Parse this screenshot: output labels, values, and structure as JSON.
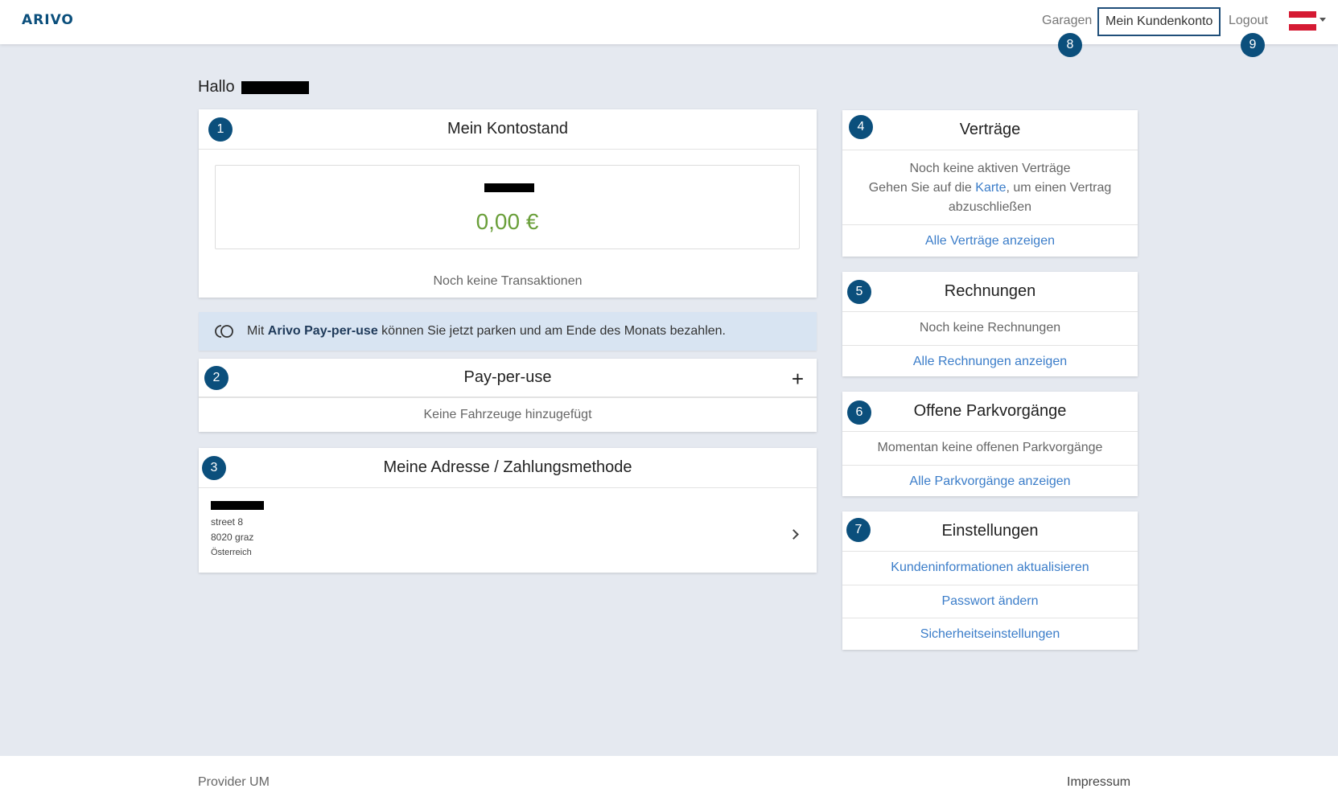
{
  "header": {
    "logo": "ARIVO",
    "nav": {
      "garagen": "Garagen",
      "konto": "Mein Kundenkonto",
      "logout": "Logout"
    }
  },
  "badges": [
    "1",
    "2",
    "3",
    "4",
    "5",
    "6",
    "7",
    "8",
    "9"
  ],
  "greeting": "Hallo",
  "kontostand": {
    "title": "Mein Kontostand",
    "amount": "0,00 €",
    "no_transactions": "Noch keine Transaktionen"
  },
  "info_banner": {
    "prefix": "Mit ",
    "brand": "Arivo Pay-per-use",
    "suffix": " können Sie jetzt parken und am Ende des Monats bezahlen."
  },
  "payperuse": {
    "title": "Pay-per-use",
    "plus": "+",
    "empty": "Keine Fahrzeuge hinzugefügt"
  },
  "adresse": {
    "title": "Meine Adresse / Zahlungsmethode",
    "street": "street 8",
    "city": "8020 graz",
    "country": "Österreich"
  },
  "vertraege": {
    "title": "Verträge",
    "empty": "Noch keine aktiven Verträge",
    "hint_pre": "Gehen Sie auf die ",
    "hint_link": "Karte",
    "hint_post": ", um einen Vertrag abzuschließen",
    "link": "Alle Verträge anzeigen"
  },
  "rechnungen": {
    "title": "Rechnungen",
    "empty": "Noch keine Rechnungen",
    "link": "Alle Rechnungen anzeigen"
  },
  "parkvorgaenge": {
    "title": "Offene Parkvorgänge",
    "empty": "Momentan keine offenen Parkvorgänge",
    "link": "Alle Parkvorgänge anzeigen"
  },
  "einstellungen": {
    "title": "Einstellungen",
    "links": [
      "Kundeninformationen aktualisieren",
      "Passwort ändern",
      "Sicherheitseinstellungen"
    ]
  },
  "footer": {
    "left": "Provider UM",
    "right": "Impressum"
  },
  "colors": {
    "brand": "#0b4f7c",
    "link": "#3b7dc9",
    "amount": "#6a9f3a",
    "banner": "#d8e4f2"
  }
}
